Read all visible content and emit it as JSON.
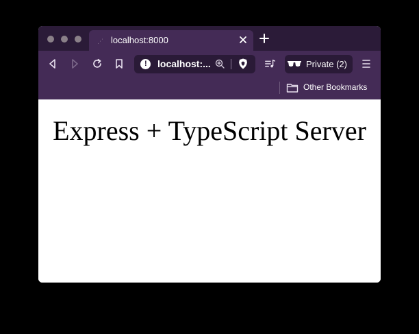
{
  "browser": {
    "tab": {
      "title": "localhost:8000"
    },
    "address_bar": {
      "url": "localhost:..."
    },
    "private_window": {
      "label": "Private (2)"
    },
    "bookmarks_bar": {
      "folder_label": "Other Bookmarks"
    },
    "colors": {
      "chrome": "#442b56",
      "tabstrip": "#2b1b38",
      "field": "#2a1a37",
      "backdrop": "#000000"
    },
    "icons": [
      "back-icon",
      "forward-icon",
      "reload-icon",
      "bookmark-icon",
      "info-icon",
      "zoom-icon",
      "brave-shield-icon",
      "playlist-icon",
      "private-glasses-icon",
      "menu-icon",
      "folder-icon",
      "close-icon",
      "plus-icon"
    ]
  },
  "page": {
    "heading": "Express + TypeScript Server"
  }
}
